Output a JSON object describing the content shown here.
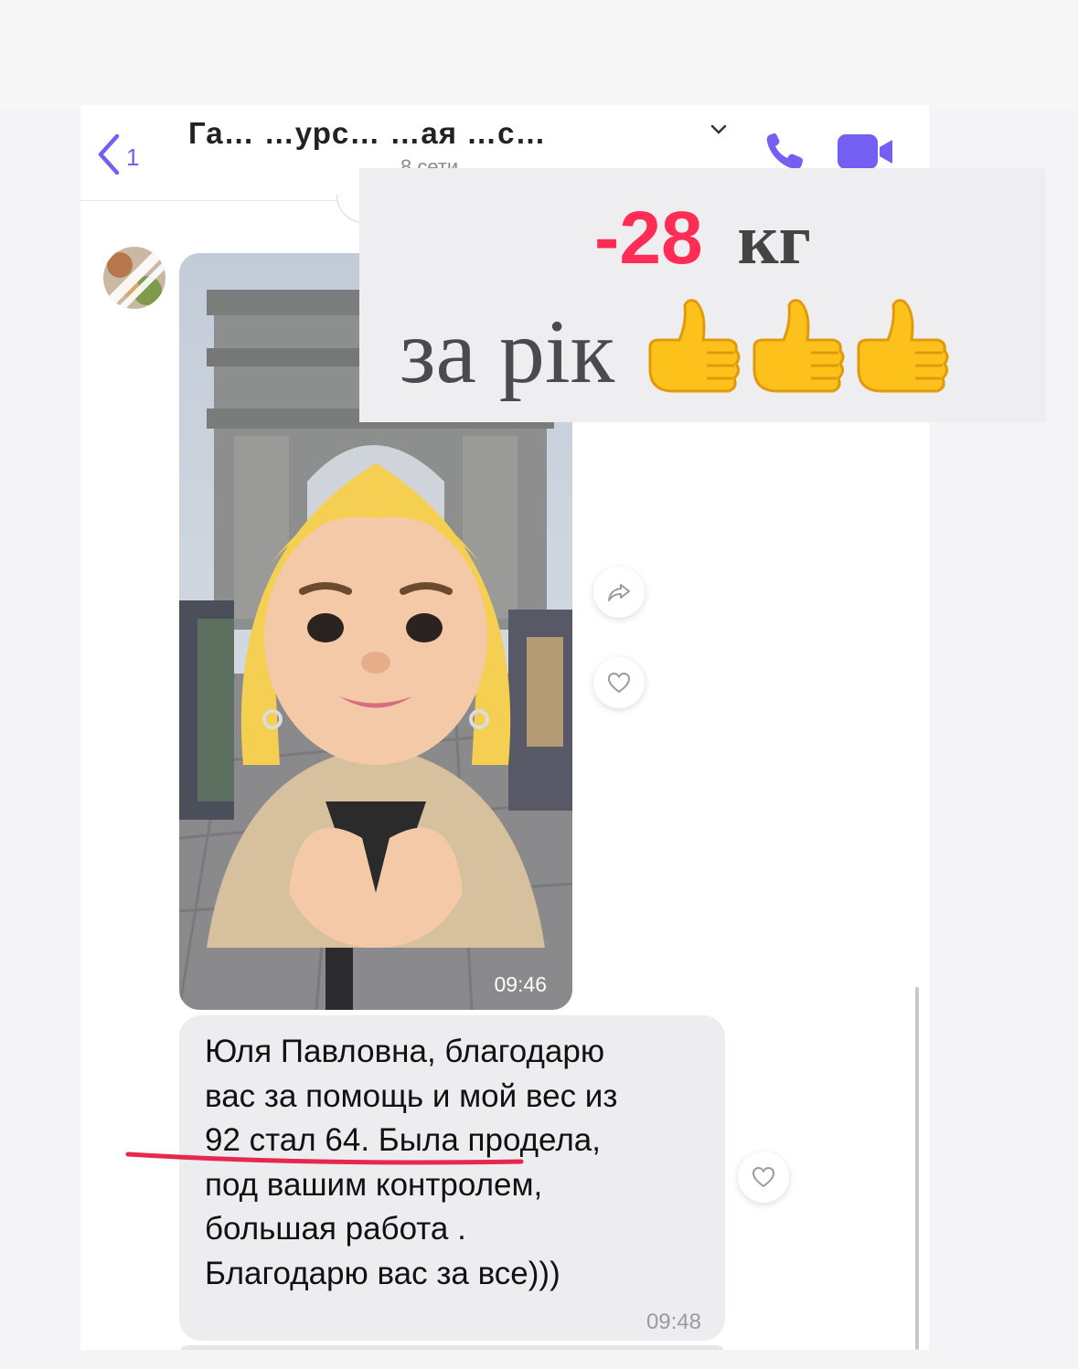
{
  "header": {
    "back_count": "1",
    "title": "Га… …урс… …ая …с…",
    "subtitle": "8 сети"
  },
  "overlay": {
    "weight_change": "-28",
    "unit": "кг",
    "period": "за рік",
    "emoji": [
      "thumbs-up",
      "thumbs-up",
      "thumbs-up"
    ]
  },
  "messages": [
    {
      "type": "photo",
      "time": "09:46"
    },
    {
      "type": "text",
      "lines": [
        "Юля Павловна, благодарю",
        "вас за помощь и мой вес из",
        "92 стал 64. Была продела,",
        "под вашим контролем,",
        "большая работа .",
        "Благодарю вас за все)))"
      ],
      "time": "09:48"
    }
  ],
  "colors": {
    "accent": "#7360f2",
    "highlight": "#ff2d55",
    "bubble": "#ededef"
  }
}
